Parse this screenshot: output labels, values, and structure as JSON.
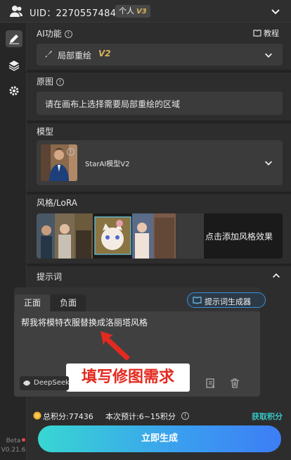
{
  "header": {
    "uid_text": "UID：2270557484",
    "account_tag": "个人",
    "account_level": "V3"
  },
  "rail": {
    "version_beta": "Beta",
    "version_number": "V0.21.6"
  },
  "ai_function": {
    "title": "AI功能",
    "tutorial_label": "教程",
    "selected": "局部重绘",
    "selected_version": "V2"
  },
  "original": {
    "title": "原图",
    "instruction": "请在画布上选择需要局部重绘的区域"
  },
  "model": {
    "title": "模型",
    "name": "StarAI模型V2"
  },
  "style": {
    "title": "风格/LoRA",
    "add_label": "点击添加风格效果"
  },
  "prompt": {
    "title": "提示词",
    "tabs": [
      "正面",
      "负面"
    ],
    "generator_label": "提示词生成器",
    "value": "帮我将模特衣服替换成洛丽塔风格",
    "engine_label": "DeepSeek",
    "annotation": "填写修图需求"
  },
  "credits": {
    "total": "总积分:77436",
    "estimate": "本次预计:6~15积分",
    "get_more": "获取积分"
  },
  "generate_label": "立即生成"
}
